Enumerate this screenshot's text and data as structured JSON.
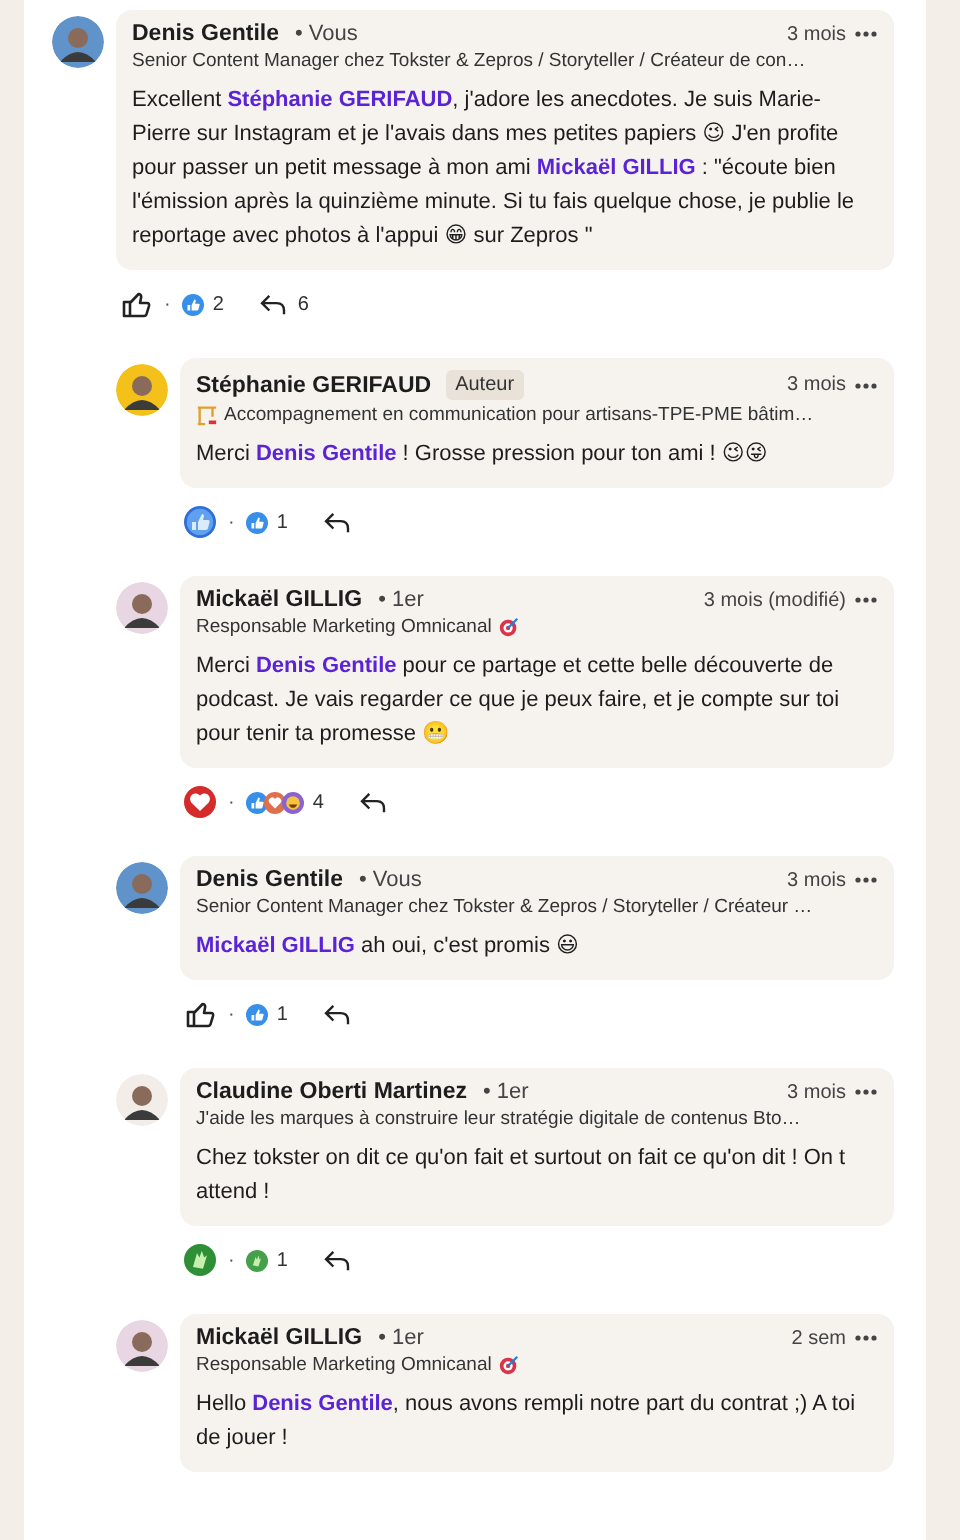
{
  "comment": {
    "author": "Denis Gentile",
    "degree": "• Vous",
    "avatar": {
      "color": "#5f93c9"
    },
    "headline": "Senior Content Manager chez Tokster & Zepros / Storyteller / Créateur de con…",
    "time": "3 mois",
    "body": [
      {
        "kind": "text",
        "text": "Excellent "
      },
      {
        "kind": "mention",
        "text": "Stéphanie GERIFAUD"
      },
      {
        "kind": "text",
        "text": ", j'adore les anecdotes. Je suis Marie-Pierre sur Instagram et je l'avais dans mes petites papiers 😉 J'en profite pour passer un petit message à mon ami "
      },
      {
        "kind": "mention",
        "text": "Mickaël GILLIG"
      },
      {
        "kind": "text",
        "text": " : \"écoute bien l'émission après la quinzième minute. Si tu fais quelque chose, je publie le reportage avec photos à l'appui 😁 sur Zepros \""
      }
    ],
    "my_reaction": {
      "kind": "like",
      "on": false
    },
    "separator": "·",
    "reaction_icons": [
      {
        "kind": "like"
      }
    ],
    "reaction_count": "2",
    "reply_count": "6",
    "replies": [
      {
        "author": "Stéphanie GERIFAUD",
        "badge": "Auteur",
        "avatar": {
          "color": "#f4c11a"
        },
        "headline_prefix_icon": {
          "kind": "crane"
        },
        "headline": "Accompagnement en communication pour artisans-TPE-PME bâtim…",
        "time": "3 mois",
        "body": [
          {
            "kind": "text",
            "text": "Merci "
          },
          {
            "kind": "mention",
            "text": "Denis Gentile"
          },
          {
            "kind": "text",
            "text": " ! Grosse pression pour ton ami ! 😉😜"
          }
        ],
        "my_reaction": {
          "kind": "like",
          "on": true
        },
        "separator": "·",
        "reaction_icons": [
          {
            "kind": "like"
          }
        ],
        "reaction_count": "1"
      },
      {
        "author": "Mickaël GILLIG",
        "degree": "• 1er",
        "avatar": {
          "color": "#e8d6e3"
        },
        "headline_suffix_icon": {
          "kind": "target"
        },
        "headline": "Responsable Marketing Omnicanal",
        "time": "3 mois (modifié)",
        "body": [
          {
            "kind": "text",
            "text": "Merci "
          },
          {
            "kind": "mention",
            "text": "Denis Gentile"
          },
          {
            "kind": "text",
            "text": " pour ce partage et cette belle découverte de podcast. Je vais regarder ce que je peux faire, et je compte sur toi pour tenir ta promesse 😬"
          }
        ],
        "my_reaction": {
          "kind": "love",
          "on": true
        },
        "separator": "·",
        "reaction_icons": [
          {
            "kind": "like"
          },
          {
            "kind": "love"
          },
          {
            "kind": "funny"
          }
        ],
        "reaction_count": "4"
      },
      {
        "author": "Denis Gentile",
        "degree": "• Vous",
        "avatar": {
          "color": "#5f93c9"
        },
        "headline": "Senior Content Manager chez Tokster & Zepros / Storyteller / Créateur …",
        "time": "3 mois",
        "body": [
          {
            "kind": "mention",
            "text": "Mickaël GILLIG"
          },
          {
            "kind": "text",
            "text": " ah oui, c'est promis 😃"
          }
        ],
        "my_reaction": {
          "kind": "like",
          "on": false
        },
        "separator": "·",
        "reaction_icons": [
          {
            "kind": "like"
          }
        ],
        "reaction_count": "1"
      },
      {
        "author": "Claudine Oberti Martinez",
        "degree": "• 1er",
        "avatar": {
          "color": "#f2ede8"
        },
        "headline": "J'aide les marques à construire leur stratégie digitale de contenus Bto…",
        "time": "3 mois",
        "body": [
          {
            "kind": "text",
            "text": "Chez tokster on dit ce qu'on fait et surtout on fait ce qu'on dit ! On t attend !"
          }
        ],
        "my_reaction": {
          "kind": "celebrate",
          "on": true
        },
        "separator": "·",
        "reaction_icons": [
          {
            "kind": "celebrate"
          }
        ],
        "reaction_count": "1"
      },
      {
        "author": "Mickaël GILLIG",
        "degree": "• 1er",
        "avatar": {
          "color": "#e8d6e3"
        },
        "headline_suffix_icon": {
          "kind": "target"
        },
        "headline": "Responsable Marketing Omnicanal",
        "time": "2 sem",
        "body": [
          {
            "kind": "text",
            "text": "Hello "
          },
          {
            "kind": "mention",
            "text": "Denis Gentile"
          },
          {
            "kind": "text",
            "text": ", nous avons rempli notre part du contrat ;) A toi de jouer !"
          }
        ]
      }
    ]
  }
}
